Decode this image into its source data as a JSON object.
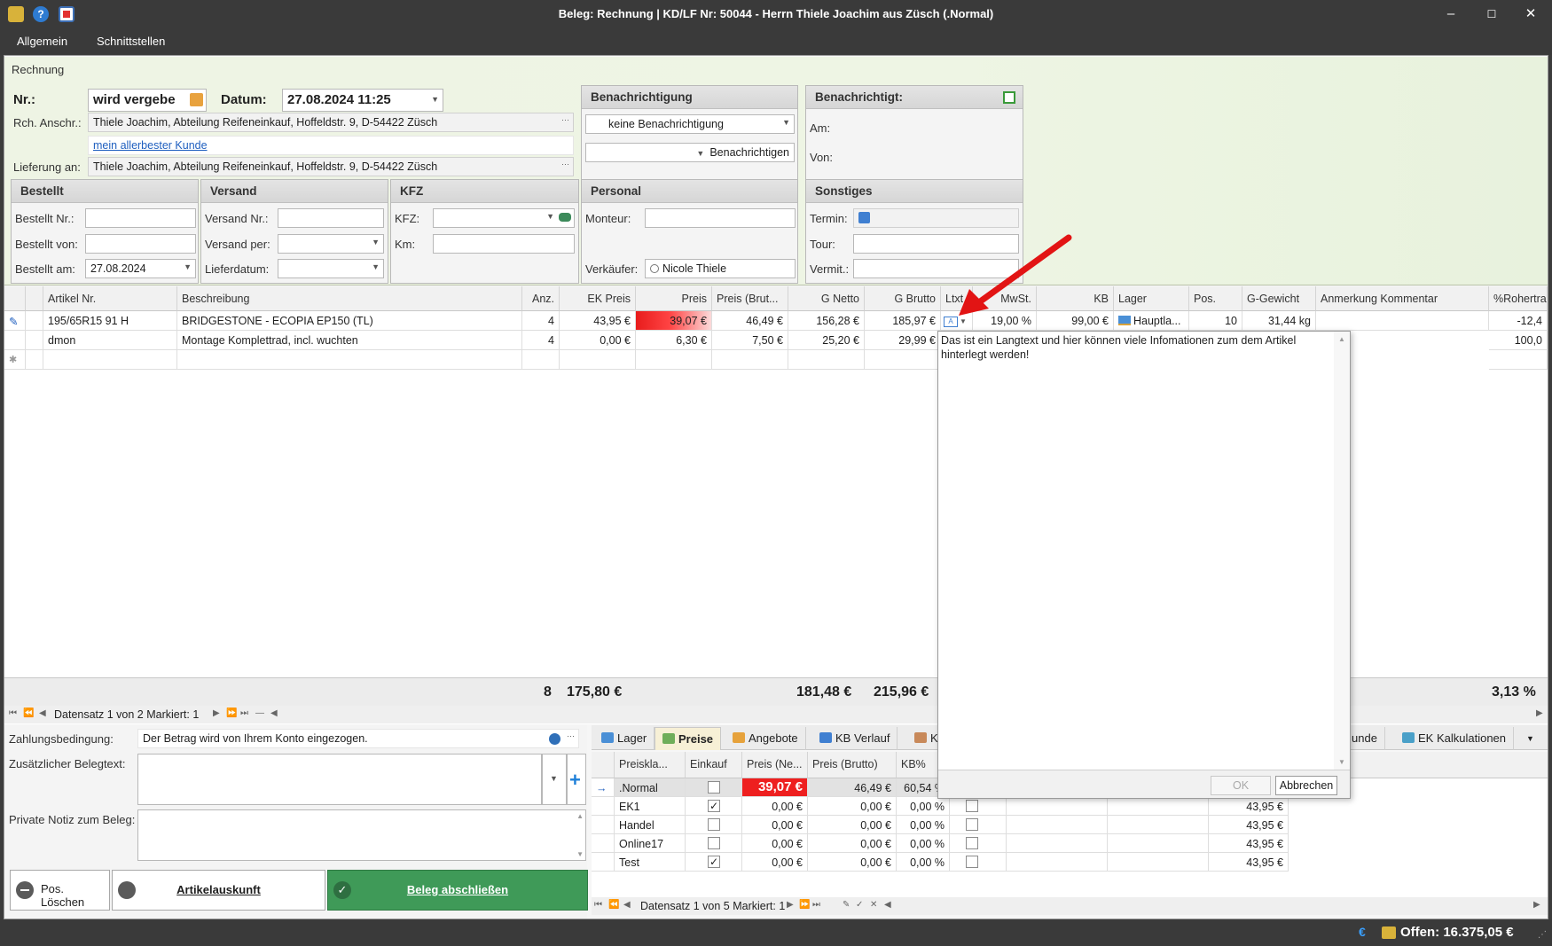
{
  "window": {
    "title": "Beleg: Rechnung |  KD/LF Nr: 50044 - Herrn Thiele Joachim aus Züsch (.Normal)"
  },
  "menu": {
    "items": [
      "Allgemein",
      "Schnittstellen"
    ]
  },
  "rechnung": {
    "section_label": "Rechnung",
    "nr_label": "Nr.:",
    "nr_value": "wird vergebe",
    "datum_label": "Datum:",
    "datum_value": "27.08.2024 11:25",
    "rch_anschr_label": "Rch. Anschr.:",
    "rch_anschr_value": "Thiele Joachim, Abteilung Reifeneinkauf, Hoffeldstr. 9, D-54422 Züsch",
    "kunde_link": "mein allerbester Kunde",
    "lieferung_label": "Lieferung an:",
    "lieferung_value": "Thiele Joachim, Abteilung Reifeneinkauf, Hoffeldstr. 9, D-54422 Züsch",
    "ellipsis": "···"
  },
  "benachrichtigung": {
    "title": "Benachrichtigung",
    "select_value": "keine Benachrichtigung",
    "button": "Benachrichtigen"
  },
  "benachrichtigt": {
    "title": "Benachrichtigt:",
    "am_label": "Am:",
    "von_label": "Von:"
  },
  "bestellt": {
    "title": "Bestellt",
    "nr_label": "Bestellt Nr.:",
    "von_label": "Bestellt von:",
    "am_label": "Bestellt am:",
    "am_value": "27.08.2024"
  },
  "versand": {
    "title": "Versand",
    "nr_label": "Versand Nr.:",
    "per_label": "Versand per:",
    "lieferdatum_label": "Lieferdatum:"
  },
  "kfz": {
    "title": "KFZ",
    "kfz_label": "KFZ:",
    "km_label": "Km:"
  },
  "personal": {
    "title": "Personal",
    "monteur_label": "Monteur:",
    "verkaeufer_label": "Verkäufer:",
    "verkaeufer_value": "Nicole Thiele"
  },
  "sonstiges": {
    "title": "Sonstiges",
    "termin_label": "Termin:",
    "tour_label": "Tour:",
    "vermit_label": "Vermit.:"
  },
  "grid": {
    "columns": [
      "Artikel Nr.",
      "Beschreibung",
      "Anz.",
      "EK Preis",
      "Preis",
      "Preis (Brut...",
      "G Netto",
      "G Brutto",
      "Ltxt",
      "MwSt.",
      "KB",
      "Lager",
      "Pos.",
      "G-Gewicht",
      "Anmerkung Kommentar",
      "%Rohertra"
    ],
    "rows": [
      {
        "artikel": "195/65R15 91 H",
        "beschreibung": "BRIDGESTONE - ECOPIA EP150 (TL)",
        "anz": "4",
        "ek": "43,95 €",
        "preis": "39,07 €",
        "preis_brutto": "46,49 €",
        "g_netto": "156,28 €",
        "g_brutto": "185,97 €",
        "mwst": "19,00 %",
        "kb": "99,00 €",
        "lager": "Hauptla...",
        "pos": "10",
        "gewicht": "31,44 kg",
        "roh": "-12,4"
      },
      {
        "artikel": "dmon",
        "beschreibung": "Montage Komplettrad, incl. wuchten",
        "anz": "4",
        "ek": "0,00 €",
        "preis": "6,30 €",
        "preis_brutto": "7,50 €",
        "g_netto": "25,20 €",
        "g_brutto": "29,99 €",
        "roh": "100,0"
      }
    ],
    "sums": {
      "anz": "8",
      "preis": "175,80 €",
      "g_netto": "181,48 €",
      "g_brutto": "215,96 €",
      "roh": "3,13 %"
    },
    "nav_text": "Datensatz 1 von 2 Markiert: 1"
  },
  "popup": {
    "text": "Das ist ein Langtext und hier können viele Infomationen zum dem Artikel hinterlegt werden!",
    "ok": "OK",
    "cancel": "Abbrechen"
  },
  "bottom": {
    "zahlung_label": "Zahlungsbedingung:",
    "zahlung_value": "Der Betrag wird von Ihrem Konto eingezogen.",
    "belegtext_label": "Zusätzlicher Belegtext:",
    "notiz_label": "Private Notiz zum Beleg:",
    "btn_loeschen": "Pos. Löschen",
    "btn_auskunft": "Artikelauskunft",
    "btn_abschliessen": "Beleg abschließen"
  },
  "tabs": [
    {
      "label": "Lager",
      "icon": "warehouse-icon"
    },
    {
      "label": "Preise",
      "icon": "prices-icon"
    },
    {
      "label": "Angebote",
      "icon": "offers-icon"
    },
    {
      "label": "KB Verlauf",
      "icon": "chart-icon"
    },
    {
      "label": "K",
      "icon": "person-icon"
    },
    {
      "label": "unde",
      "icon": ""
    },
    {
      "label": "EK Kalkulationen",
      "icon": "calc-icon"
    }
  ],
  "prices": {
    "columns": [
      "Preiskla...",
      "Einkauf",
      "Preis (Ne...",
      "Preis (Brutto)",
      "KB%"
    ],
    "rows": [
      {
        "name": ".Normal",
        "einkauf": false,
        "netto": "39,07 €",
        "brutto": "46,49 €",
        "kb": "60,54 %",
        "ek": ""
      },
      {
        "name": "EK1",
        "einkauf": true,
        "netto": "0,00 €",
        "brutto": "0,00 €",
        "kb": "0,00 %",
        "ek": "43,95 €"
      },
      {
        "name": "Handel",
        "einkauf": false,
        "netto": "0,00 €",
        "brutto": "0,00 €",
        "kb": "0,00 %",
        "ek": "43,95 €"
      },
      {
        "name": "Online17",
        "einkauf": false,
        "netto": "0,00 €",
        "brutto": "0,00 €",
        "kb": "0,00 %",
        "ek": "43,95 €"
      },
      {
        "name": "Test",
        "einkauf": true,
        "netto": "0,00 €",
        "brutto": "0,00 €",
        "kb": "0,00 %",
        "ek": "43,95 €"
      }
    ],
    "nav_text": "Datensatz 1 von 5 Markiert: 1"
  },
  "status": {
    "offen": "Offen: 16.375,05 €",
    "euro": "€"
  },
  "colors": {
    "accent_red": "#ee1f1f",
    "green_button": "#3f9a58",
    "header_bg": "#eef4e4"
  }
}
